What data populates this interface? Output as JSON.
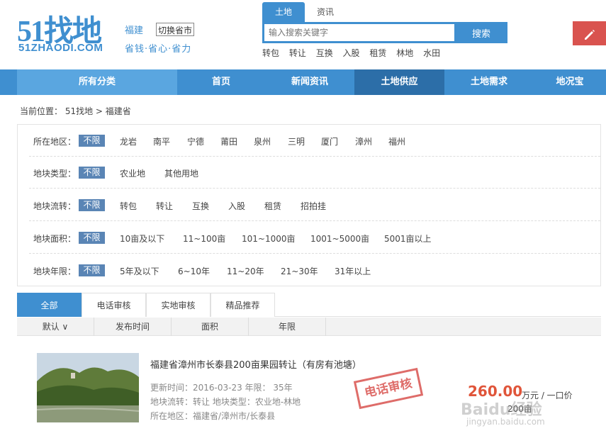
{
  "header": {
    "logo_main": "51找地",
    "logo_sub": "51ZHAODI.COM",
    "province": "福建",
    "switch_label": "切换省市",
    "slogan": "省钱·省心·省力",
    "search_tabs": [
      "土地",
      "资讯"
    ],
    "search_placeholder": "输入搜索关键字",
    "search_button": "搜索",
    "hot_words": [
      "转包",
      "转让",
      "互换",
      "入股",
      "租赁",
      "林地",
      "水田"
    ],
    "edit_icon": "pencil-icon"
  },
  "nav": {
    "category": "所有分类",
    "items": [
      "首页",
      "新闻资讯",
      "土地供应",
      "土地需求",
      "地况宝"
    ]
  },
  "breadcrumb": "当前位置： 51找地 > 福建省",
  "filters": [
    {
      "label": "所在地区：",
      "selected": "不限",
      "options": [
        "龙岩",
        "南平",
        "宁德",
        "莆田",
        "泉州",
        "三明",
        "厦门",
        "漳州",
        "福州"
      ]
    },
    {
      "label": "地块类型：",
      "selected": "不限",
      "options": [
        "农业地",
        "其他用地"
      ]
    },
    {
      "label": "地块流转：",
      "selected": "不限",
      "options": [
        "转包",
        "转让",
        "互换",
        "入股",
        "租赁",
        "招拍挂"
      ]
    },
    {
      "label": "地块面积：",
      "selected": "不限",
      "options": [
        "10亩及以下",
        "11~100亩",
        "101~1000亩",
        "1001~5000亩",
        "5001亩以上"
      ]
    },
    {
      "label": "地块年限：",
      "selected": "不限",
      "options": [
        "5年及以下",
        "6~10年",
        "11~20年",
        "21~30年",
        "31年以上"
      ]
    }
  ],
  "tabs": [
    "全部",
    "电话审核",
    "实地审核",
    "精品推荐"
  ],
  "sort": [
    "默认 ∨",
    "发布时间",
    "面积",
    "年限"
  ],
  "listing": {
    "title": "福建省漳州市长泰县200亩果园转让（有房有池塘）",
    "meta1": "更新时间：2016-03-23 年限： 35年",
    "meta2": "地块流转：转让 地块类型：农业地-林地",
    "meta3": "所在地区：福建省/漳州市/长泰县",
    "stamp": "电话审核",
    "price": "260.00",
    "unit": "万元 / 一口价",
    "area": "200亩"
  },
  "watermark": {
    "main": "Baidu经验",
    "sub": "jingyan.baidu.com"
  },
  "colors": {
    "brand": "#3f8fd0",
    "nav_active": "#2c6ea8",
    "accent": "#d9534f",
    "price": "#e0553a"
  }
}
